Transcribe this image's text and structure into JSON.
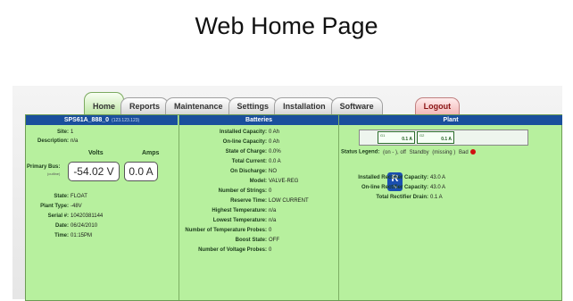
{
  "slide_title": "Web Home Page",
  "tabs": [
    "Home",
    "Reports",
    "Maintenance",
    "Settings",
    "Installation",
    "Software"
  ],
  "logout_label": "Logout",
  "system": {
    "header": "SPS61A_888_0",
    "header_sub": "(123.123.123)",
    "site_label": "Site:",
    "site_value": "1",
    "description_label": "Description:",
    "description_value": "n/a",
    "volts_label": "Volts",
    "amps_label": "Amps",
    "bus_label": "Primary Bus:",
    "bus_sub": "(outline)",
    "bus_volts": "-54.02 V",
    "bus_amps": "0.0 A",
    "state_label": "State:",
    "state_value": "FLOAT",
    "plant_type_label": "Plant Type:",
    "plant_type_value": "-48V",
    "serial_label": "Serial #:",
    "serial_value": "10420381144",
    "date_label": "Date:",
    "date_value": "06/24/2010",
    "time_label": "Time:",
    "time_value": "01:15PM"
  },
  "batteries": {
    "header": "Batteries",
    "rows": [
      {
        "label": "Installed Capacity:",
        "value": "0 Ah"
      },
      {
        "label": "On-line Capacity:",
        "value": "0 Ah"
      },
      {
        "label": "State of Charge:",
        "value": "0.0%"
      },
      {
        "label": "Total Current:",
        "value": "0.0 A"
      },
      {
        "label": "On Discharge:",
        "value": "NO"
      },
      {
        "label": "Model:",
        "value": "VALVE-REG"
      },
      {
        "label": "Number of Strings:",
        "value": "0"
      },
      {
        "label": "Reserve Time:",
        "value": "LOW CURRENT"
      },
      {
        "label": "Highest Temperature:",
        "value": "n/a"
      },
      {
        "label": "Lowest Temperature:",
        "value": "n/a"
      },
      {
        "label": "Number of Temperature Probes:",
        "value": "0"
      },
      {
        "label": "Boost State:",
        "value": "OFF"
      },
      {
        "label": "Number of Voltage Probes:",
        "value": "0"
      }
    ]
  },
  "plant": {
    "header": "Plant",
    "slots": [
      {
        "id": "G1",
        "amps": "0.1 A"
      },
      {
        "id": "G2",
        "amps": "0.1 A"
      }
    ],
    "legend_label": "Status Legend:",
    "legend_items": [
      "(on - ), off",
      "Standby",
      "(missing )",
      "Bad"
    ],
    "rectifier_logo": "R",
    "rectifier_rows": [
      {
        "label": "Installed Rectifier Capacity:",
        "value": "43.0 A"
      },
      {
        "label": "On-line Rectifier Capacity:",
        "value": "43.0 A"
      },
      {
        "label": "Total Rectifier Drain:",
        "value": "0.1 A"
      }
    ]
  }
}
